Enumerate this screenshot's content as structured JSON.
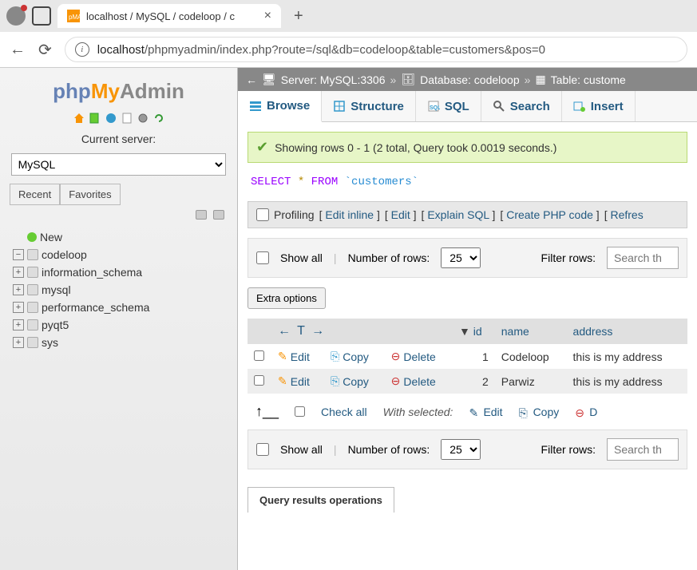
{
  "browser": {
    "tab_title": "localhost / MySQL / codeloop / c",
    "url_host": "localhost",
    "url_path": "/phpmyadmin/index.php?route=/sql&db=codeloop&table=customers&pos=0"
  },
  "logo": {
    "p1": "php",
    "p2": "My",
    "p3": "Admin"
  },
  "sidebar": {
    "current_server_label": "Current server:",
    "server_value": "MySQL",
    "recent": "Recent",
    "favorites": "Favorites",
    "new_label": "New",
    "databases": [
      "codeloop",
      "information_schema",
      "mysql",
      "performance_schema",
      "pyqt5",
      "sys"
    ]
  },
  "breadcrumb": {
    "server_label": "Server: MySQL:3306",
    "db_label": "Database: codeloop",
    "table_label": "Table: custome"
  },
  "tabs": {
    "browse": "Browse",
    "structure": "Structure",
    "sql": "SQL",
    "search": "Search",
    "insert": "Insert"
  },
  "success": "Showing rows 0 - 1 (2 total, Query took 0.0019 seconds.)",
  "sql": {
    "select": "SELECT",
    "star": "*",
    "from": "FROM",
    "table": "`customers`"
  },
  "actions": {
    "profiling": "Profiling",
    "edit_inline": "Edit inline",
    "edit": "Edit",
    "explain_sql": "Explain SQL",
    "create_php": "Create PHP code",
    "refresh": "Refres"
  },
  "filter": {
    "show_all": "Show all",
    "num_rows_label": "Number of rows:",
    "num_rows_value": "25",
    "filter_rows_label": "Filter rows:",
    "filter_placeholder": "Search th"
  },
  "extra_options": "Extra options",
  "columns": {
    "id": "id",
    "name": "name",
    "address": "address"
  },
  "rows": [
    {
      "id": "1",
      "name": "Codeloop",
      "address": "this is my address"
    },
    {
      "id": "2",
      "name": "Parwiz",
      "address": "this is my address"
    }
  ],
  "row_actions": {
    "edit": "Edit",
    "copy": "Copy",
    "delete": "Delete"
  },
  "bulk": {
    "check_all": "Check all",
    "with_selected": "With selected:",
    "edit": "Edit",
    "copy": "Copy",
    "delete": "D"
  },
  "results_ops": "Query results operations"
}
